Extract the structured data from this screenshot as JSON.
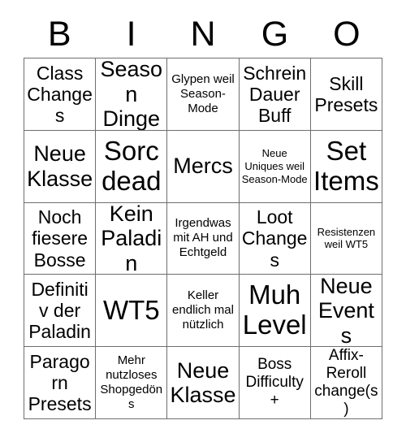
{
  "card": {
    "background_color": "#ffffff",
    "text_color": "#000000",
    "border_color": "#6e6e6e",
    "header": {
      "letters": [
        "B",
        "I",
        "N",
        "G",
        "O"
      ]
    },
    "grid": {
      "columns": 5,
      "rows": 5,
      "cells": [
        {
          "text": "Class Changes",
          "size": "lg"
        },
        {
          "text": "Season Dinge",
          "size": "xl"
        },
        {
          "text": "Glypen weil Season-Mode",
          "size": "sm"
        },
        {
          "text": "Schrein Dauer Buff",
          "size": "lg"
        },
        {
          "text": "Skill Presets",
          "size": "lg"
        },
        {
          "text": "Neue Klasse",
          "size": "xl"
        },
        {
          "text": "Sorc dead",
          "size": "xxl"
        },
        {
          "text": "Mercs",
          "size": "xl"
        },
        {
          "text": "Neue Uniques weil Season-Mode",
          "size": "xs"
        },
        {
          "text": "Set Items",
          "size": "xxl"
        },
        {
          "text": "Noch fiesere Bosse",
          "size": "lg"
        },
        {
          "text": "Kein Paladin",
          "size": "xl"
        },
        {
          "text": "Irgendwas mit AH und Echtgeld",
          "size": "sm"
        },
        {
          "text": "Loot Changes",
          "size": "lg"
        },
        {
          "text": "Resistenzen weil WT5",
          "size": "xs"
        },
        {
          "text": "Definitiv der Paladin",
          "size": "lg"
        },
        {
          "text": "WT5",
          "size": "xxl"
        },
        {
          "text": "Keller endlich mal nützlich",
          "size": "sm"
        },
        {
          "text": "Muh Level",
          "size": "xxl"
        },
        {
          "text": "Neue Events",
          "size": "xl"
        },
        {
          "text": "Paragorn Presets",
          "size": "lg"
        },
        {
          "text": "Mehr nutzloses Shopgedöns",
          "size": "sm"
        },
        {
          "text": "Neue Klasse",
          "size": "xl"
        },
        {
          "text": "Boss Difficulty+",
          "size": "md"
        },
        {
          "text": "Affix-Reroll change(s)",
          "size": "md"
        }
      ]
    }
  }
}
